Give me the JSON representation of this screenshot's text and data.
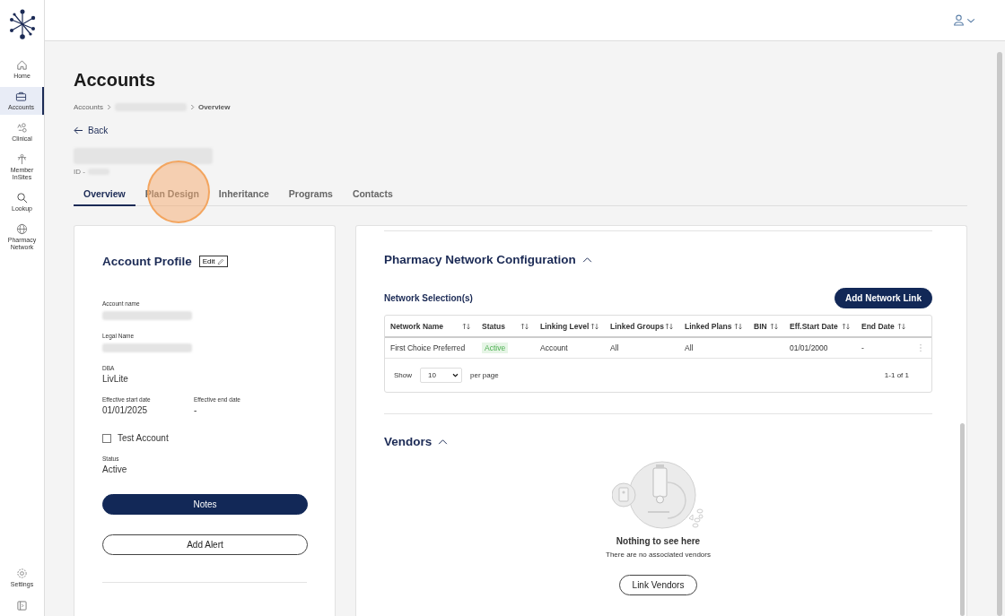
{
  "sidebar": {
    "items": [
      {
        "label": "Home",
        "selected": false
      },
      {
        "label": "Accounts",
        "selected": true
      },
      {
        "label": "Clinical",
        "selected": false
      },
      {
        "label": "Member InSites",
        "selected": false
      },
      {
        "label": "Lookup",
        "selected": false
      },
      {
        "label": "Pharmacy Network",
        "selected": false
      }
    ],
    "settings": "Settings"
  },
  "page": {
    "title": "Accounts",
    "breadcrumb": [
      "Accounts",
      "Overview"
    ],
    "back": "Back",
    "id_label": "ID -"
  },
  "tabs": [
    {
      "label": "Overview",
      "selected": true
    },
    {
      "label": "Plan Design",
      "selected": false
    },
    {
      "label": "Inheritance",
      "selected": false
    },
    {
      "label": "Programs",
      "selected": false
    },
    {
      "label": "Contacts",
      "selected": false
    }
  ],
  "profile": {
    "title": "Account Profile",
    "edit": "Edit",
    "account_name_label": "Account name",
    "legal_name_label": "Legal Name",
    "dba": {
      "label": "DBA",
      "value": "LivLite"
    },
    "start": {
      "label": "Effective start date",
      "value": "01/01/2025"
    },
    "end": {
      "label": "Effective end date",
      "value": "-"
    },
    "test_account": {
      "label": "Test Account",
      "checked": false
    },
    "status": {
      "label": "Status",
      "value": "Active"
    },
    "notes_button": "Notes",
    "alert_button": "Add Alert"
  },
  "network": {
    "title": "Pharmacy Network Configuration",
    "expanded": true,
    "subtitle": "Network Selection(s)",
    "add_button": "Add Network Link",
    "columns": [
      "Network Name",
      "Status",
      "Linking Level",
      "Linked Groups",
      "Linked Plans",
      "BIN",
      "Eff.Start Date",
      "End Date"
    ],
    "rows": [
      {
        "cells": [
          "First Choice Preferred",
          "Active",
          "Account",
          "All",
          "All",
          null,
          "01/01/2000",
          "-"
        ]
      }
    ],
    "show": "Show",
    "page_size": "10",
    "per_page": "per page",
    "range": "1-1 of 1"
  },
  "vendors": {
    "title": "Vendors",
    "expanded": true,
    "empty_title": "Nothing to see here",
    "empty_text": "There are no associated vendors",
    "button": "Link Vendors"
  }
}
